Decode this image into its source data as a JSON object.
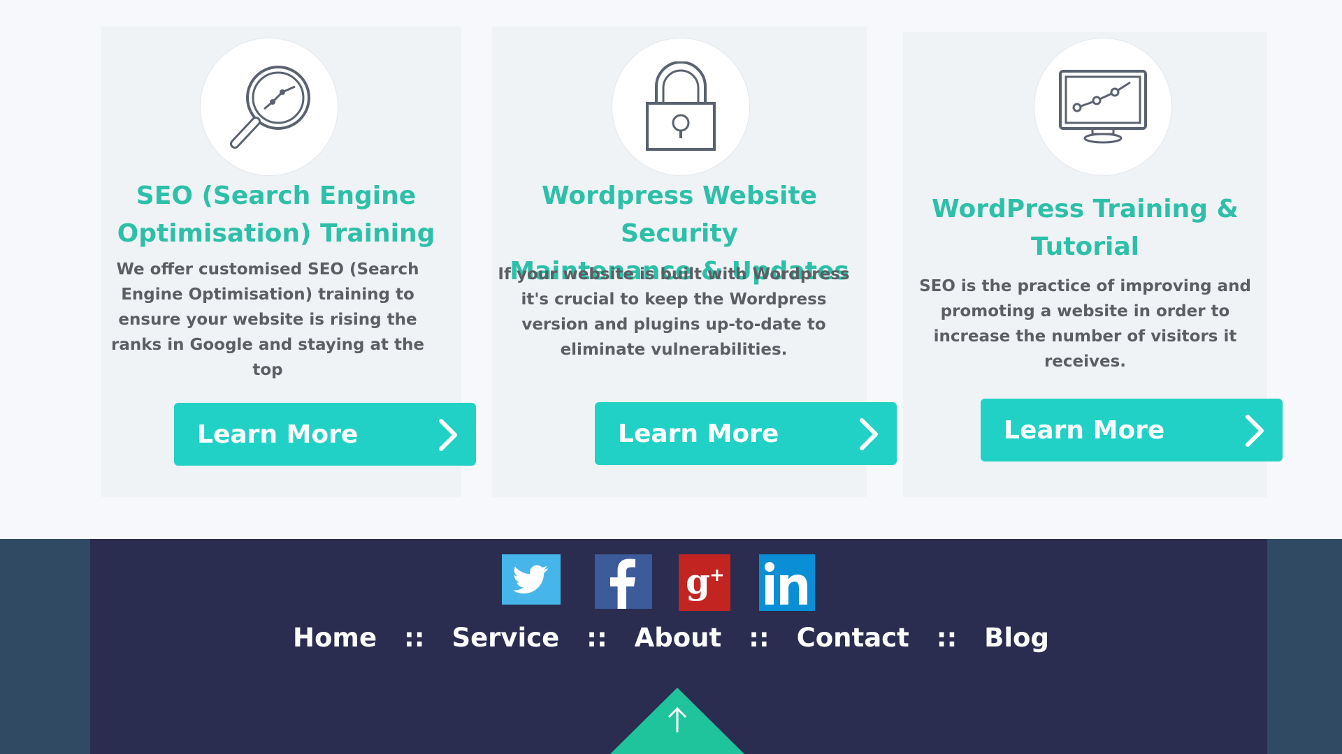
{
  "cards": [
    {
      "icon": "search-chart-icon",
      "title_line1": "SEO (Search Engine",
      "title_line2": "Optimisation) Training",
      "desc": [
        "We offer customised SEO (Search",
        "Engine Optimisation) training to",
        "ensure your website is rising the",
        "ranks in Google and staying at the",
        "top"
      ],
      "button": "Learn More"
    },
    {
      "icon": "padlock-icon",
      "title_line1": "Wordpress Website Security",
      "title_line2": "Maintenance & Updates",
      "desc": [
        "If your website is built with Wordpress",
        "it's crucial to keep the Wordpress",
        "version and plugins up-to-date to",
        "eliminate vulnerabilities."
      ],
      "button": "Learn More"
    },
    {
      "icon": "monitor-chart-icon",
      "title_line1": "WordPress Training  &",
      "title_line2": "Tutorial",
      "desc": [
        "SEO is the practice of improving and",
        "promoting a website in order to",
        "increase the number of visitors it",
        "receives."
      ],
      "button": "Learn More"
    }
  ],
  "footer": {
    "social": [
      "twitter",
      "facebook",
      "google-plus",
      "linkedin"
    ],
    "nav": [
      "Home",
      "Service",
      "About",
      "Contact",
      "Blog"
    ],
    "separator": "::"
  },
  "colors": {
    "accent": "#2ebfa8",
    "button": "#22d1c6",
    "footer": "#2a2d4f",
    "footer_side": "#2f4a62",
    "totop": "#1fc49c"
  }
}
